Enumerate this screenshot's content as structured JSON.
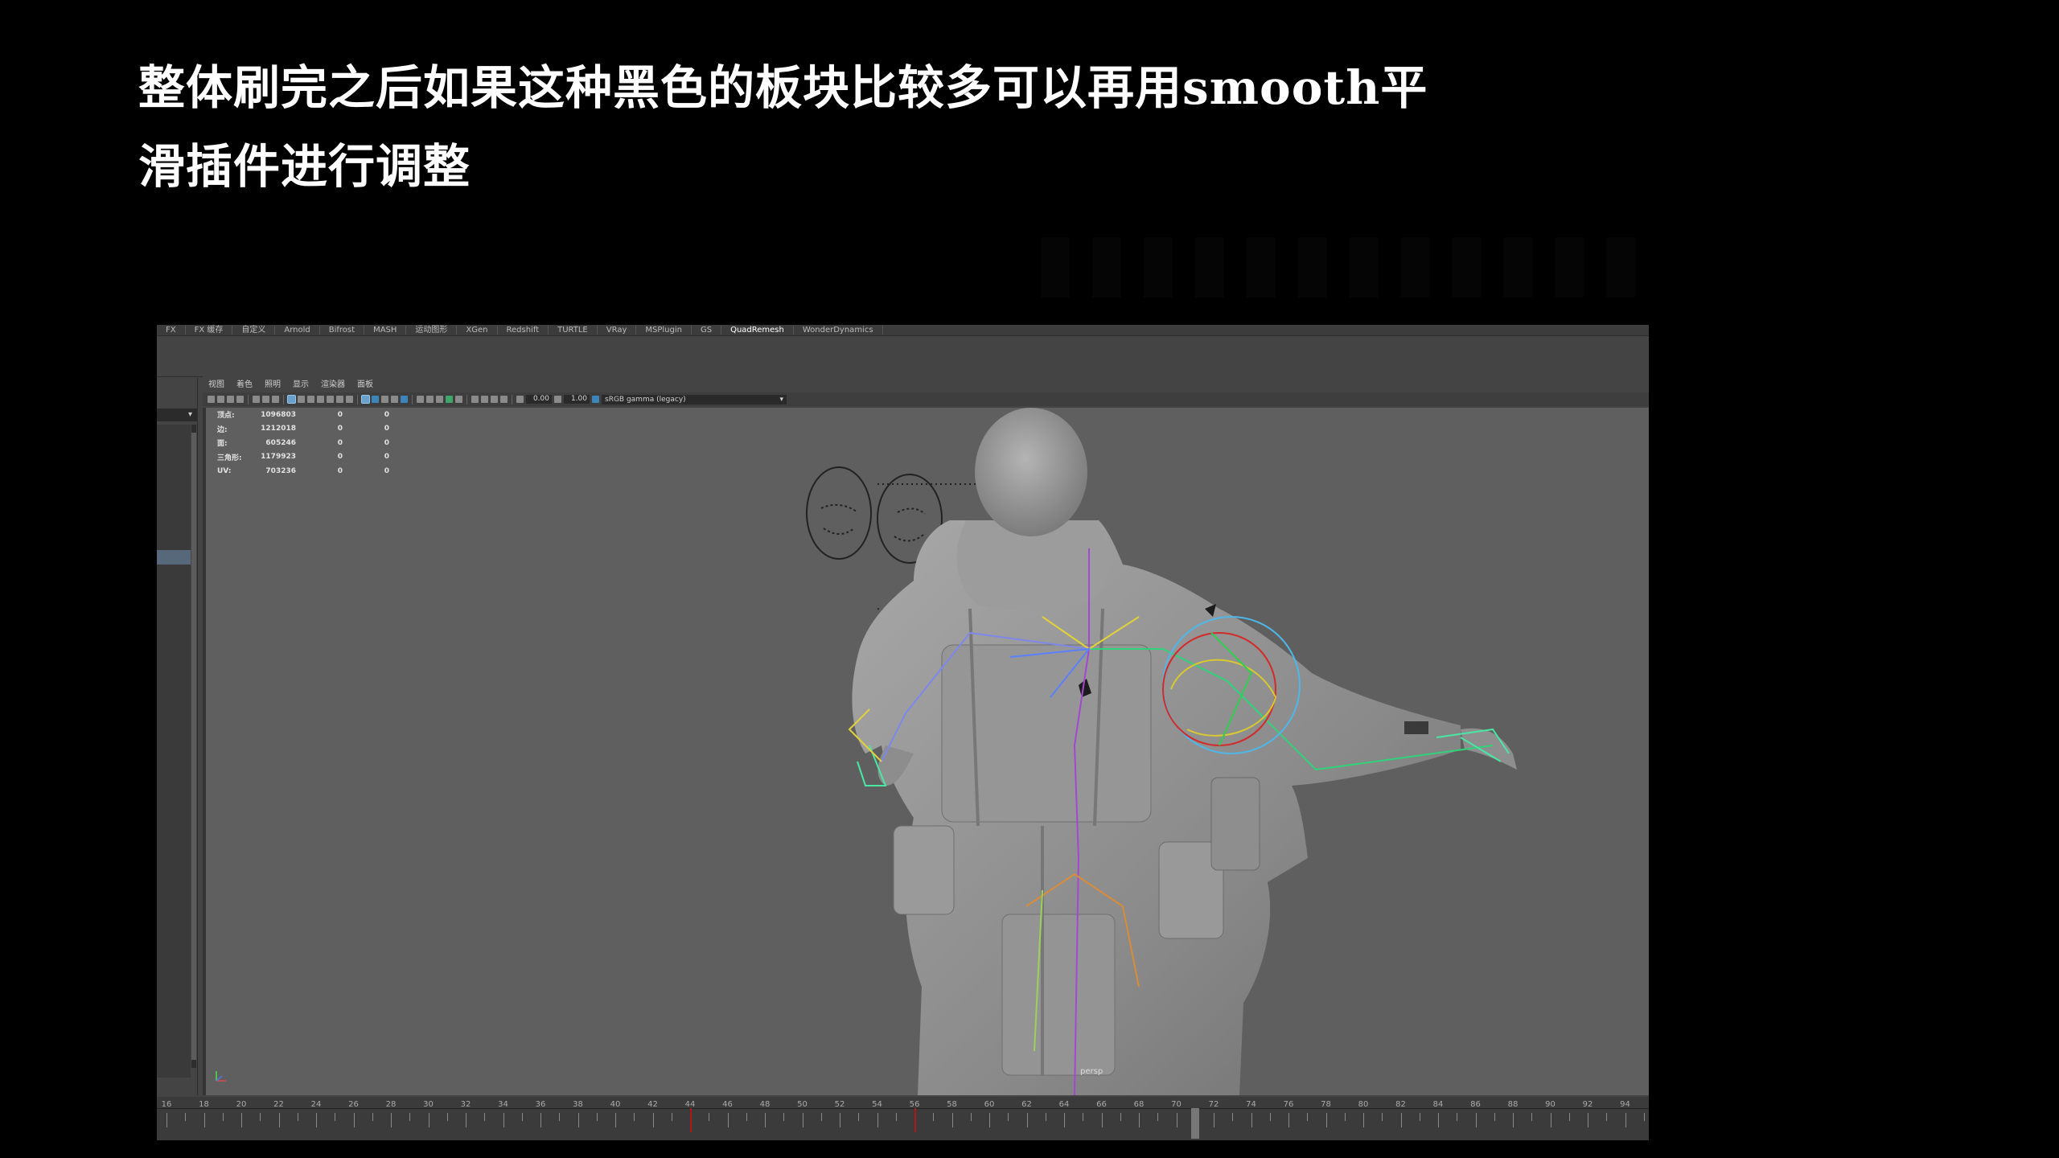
{
  "slide": {
    "title_line1": "整体刷完之后如果这种黑色的板块比较多可以再用smooth平",
    "title_line2": "滑插件进行调整"
  },
  "maya": {
    "shelf_tabs": [
      "FX",
      "FX 缓存",
      "自定义",
      "Arnold",
      "Bifrost",
      "MASH",
      "运动图形",
      "XGen",
      "Redshift",
      "TURTLE",
      "VRay",
      "MSPlugin",
      "GS",
      "QuadRemesh",
      "WonderDynamics"
    ],
    "active_shelf_tab": "QuadRemesh",
    "viewport_menu": [
      "视图",
      "着色",
      "照明",
      "显示",
      "渲染器",
      "面板"
    ],
    "exposure_value": "0.00",
    "gamma_value": "1.00",
    "color_space": "sRGB gamma (legacy)",
    "hud": [
      {
        "label": "顶点:",
        "value": "1096803",
        "c1": "0",
        "c2": "0"
      },
      {
        "label": "边:",
        "value": "1212018",
        "c1": "0",
        "c2": "0"
      },
      {
        "label": "面:",
        "value": "605246",
        "c1": "0",
        "c2": "0"
      },
      {
        "label": "三角形:",
        "value": "1179923",
        "c1": "0",
        "c2": "0"
      },
      {
        "label": "UV:",
        "value": "703236",
        "c1": "0",
        "c2": "0"
      }
    ],
    "camera_label": "persp",
    "timeline": {
      "labels": [
        "16",
        "18",
        "20",
        "22",
        "24",
        "26",
        "28",
        "30",
        "32",
        "34",
        "36",
        "38",
        "40",
        "42",
        "44",
        "46",
        "48",
        "50",
        "52",
        "54",
        "56",
        "58",
        "60",
        "62",
        "64",
        "66",
        "68",
        "70",
        "72",
        "74",
        "76",
        "78",
        "80",
        "82",
        "84",
        "86",
        "88",
        "90",
        "92",
        "94"
      ],
      "keyframes": [
        44,
        56
      ],
      "current_frame": 71
    }
  },
  "colors": {
    "background": "#000000",
    "maya_panel": "#444444",
    "viewport_bg": "#5f5f5f",
    "selection_blue": "#56687a",
    "key_red": "#b01818"
  }
}
